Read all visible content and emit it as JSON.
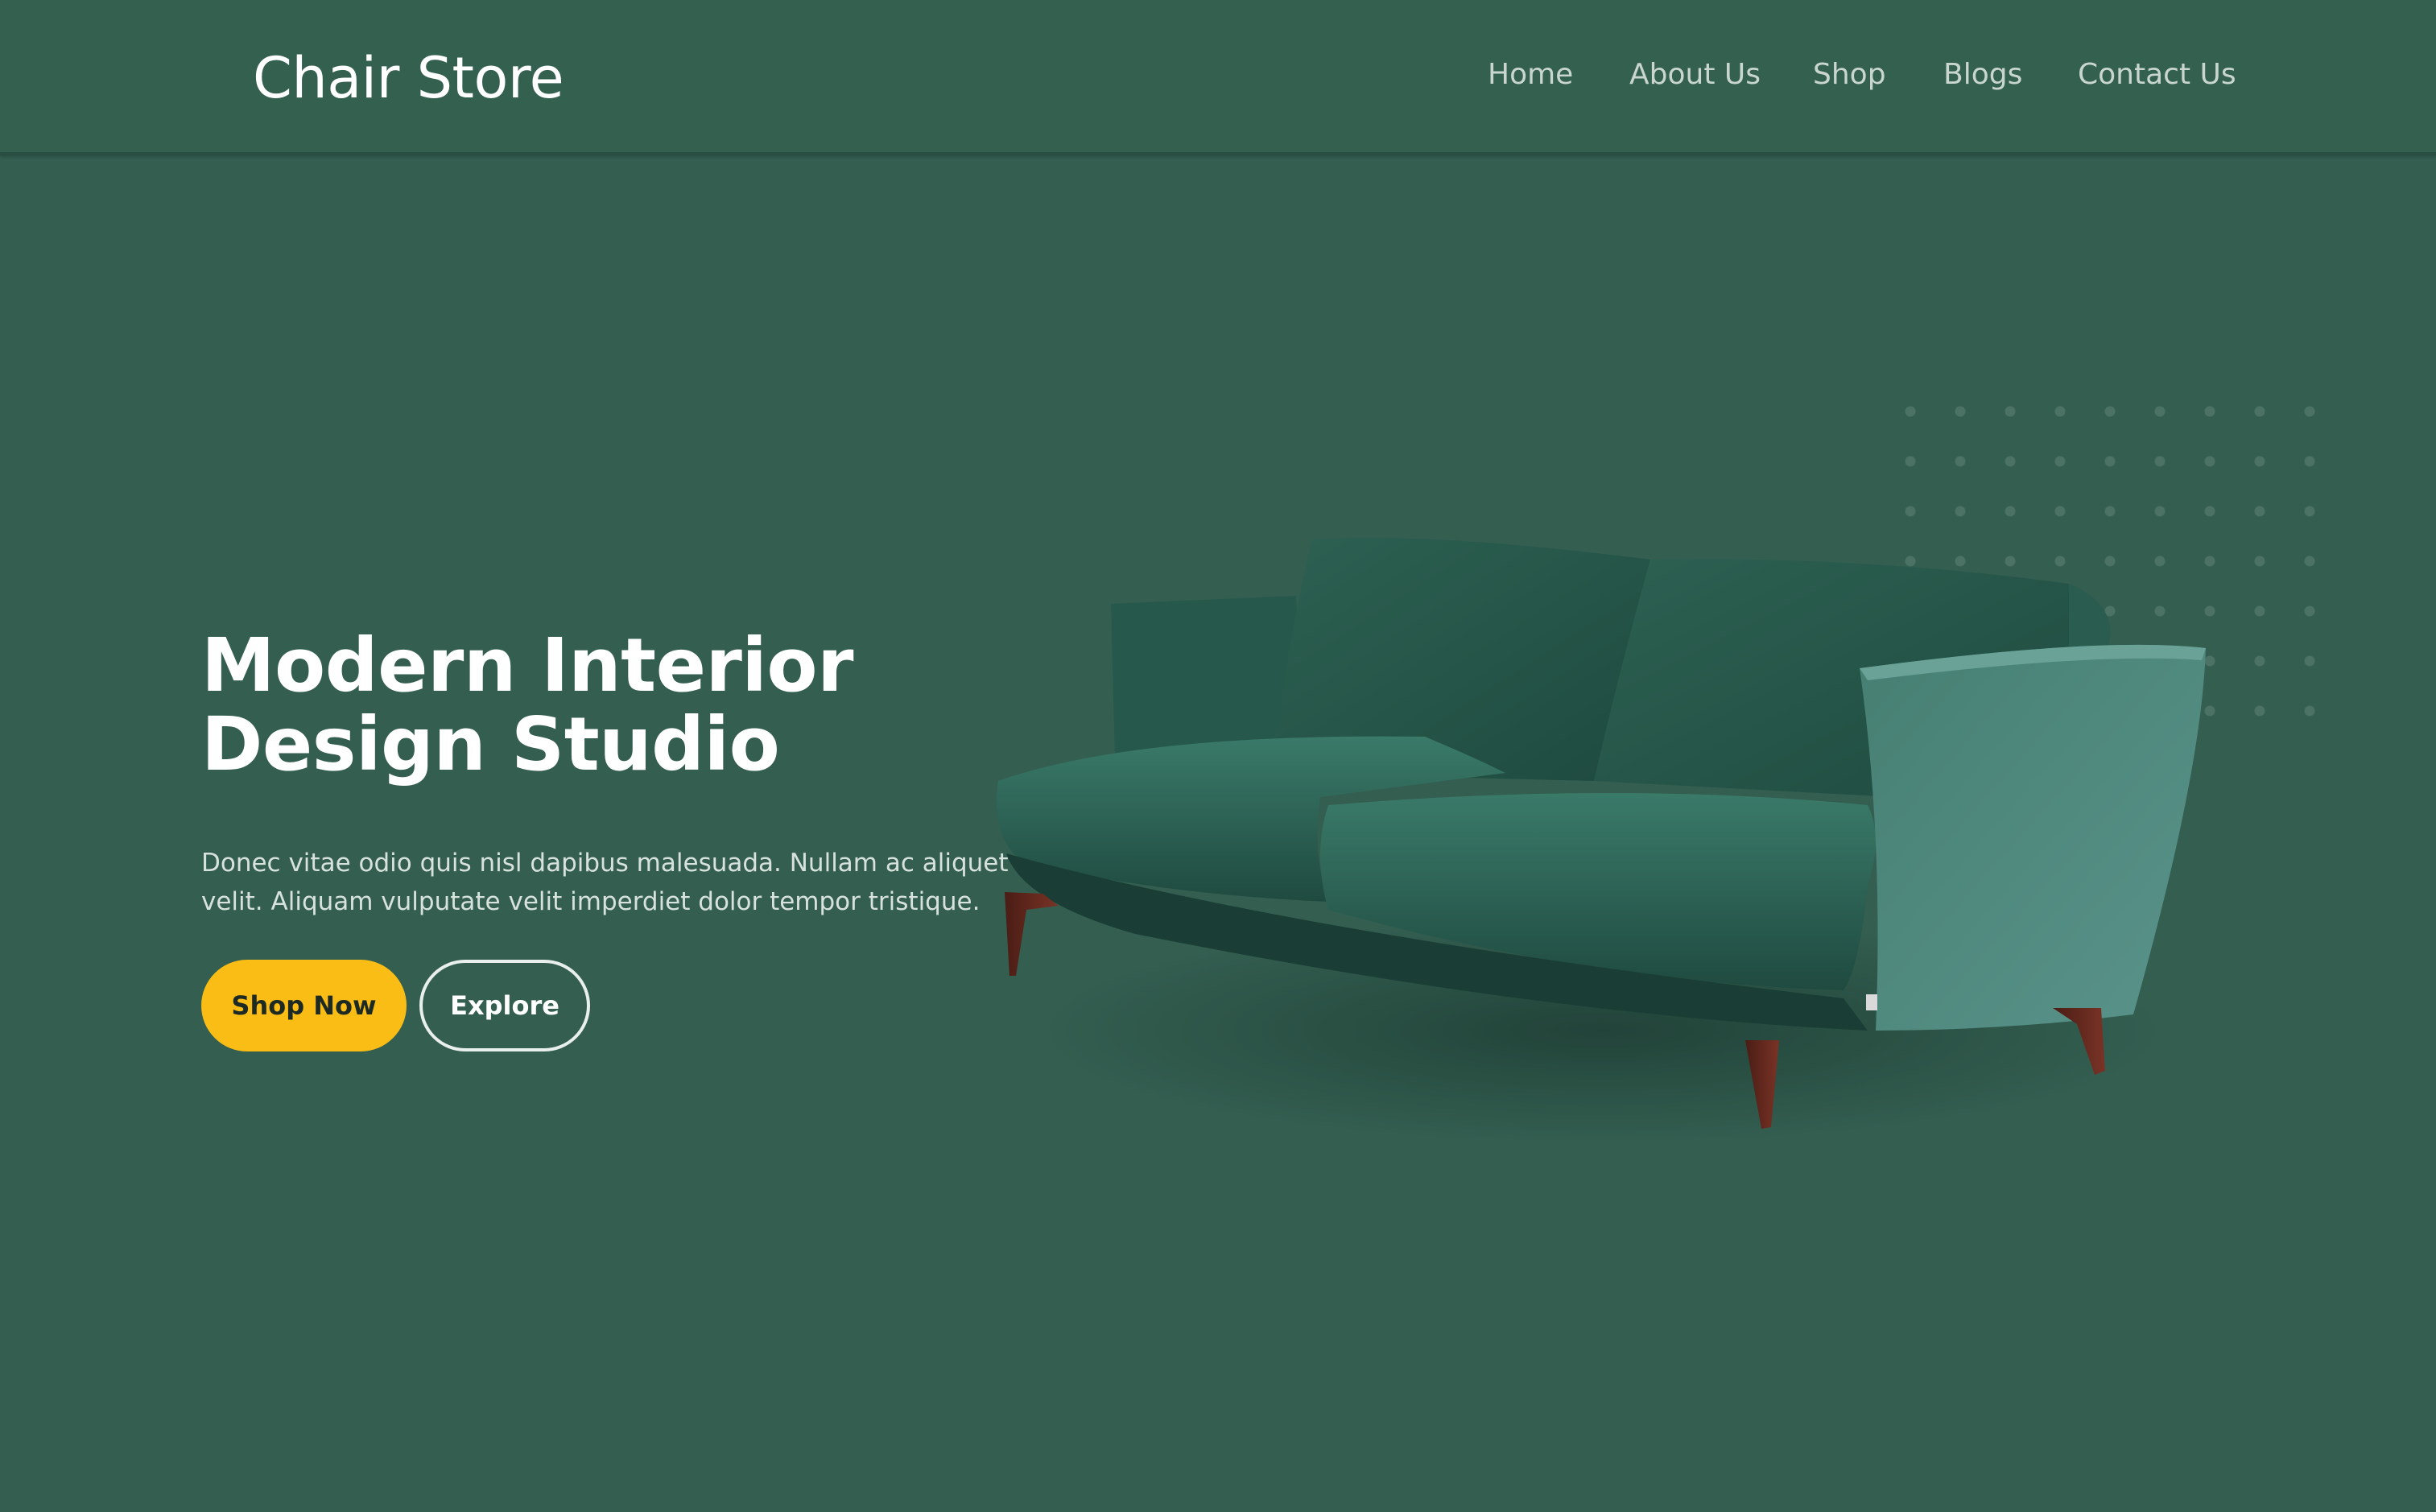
{
  "brand": {
    "name": "Chair Store"
  },
  "nav": {
    "items": [
      {
        "label": "Home"
      },
      {
        "label": "About Us"
      },
      {
        "label": "Shop"
      },
      {
        "label": "Blogs"
      },
      {
        "label": "Contact Us"
      }
    ]
  },
  "hero": {
    "title_line1": "Modern Interior",
    "title_line2": "Design Studio",
    "desc_line1": "Donec vitae odio quis nisl dapibus malesuada. Nullam ac aliquet",
    "desc_line2": "velit. Aliquam vulputate velit imperdiet dolor tempor tristique.",
    "shop_button": "Shop Now",
    "explore_button": "Explore"
  },
  "colors": {
    "background": "#335e50",
    "accent": "#f9bd15",
    "sofa": "#2f6557"
  },
  "icons": {
    "hero_image": "green-sofa-image"
  }
}
